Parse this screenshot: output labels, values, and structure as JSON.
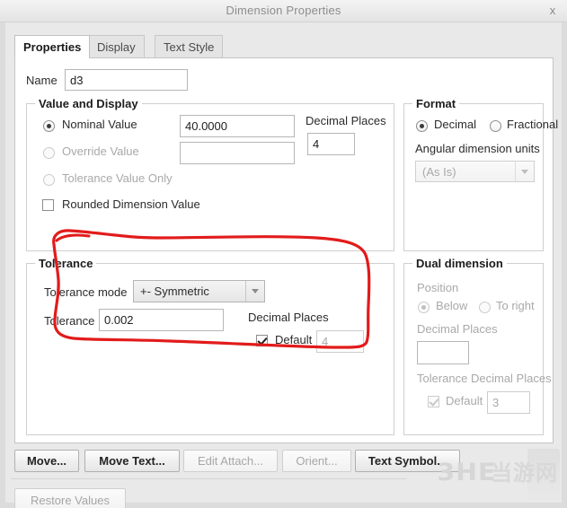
{
  "window": {
    "title": "Dimension Properties",
    "close_label": "x"
  },
  "tabs": [
    {
      "label": "Properties",
      "active": true
    },
    {
      "label": "Display",
      "active": false
    },
    {
      "label": "Text Style",
      "active": false
    }
  ],
  "name_field": {
    "label": "Name",
    "value": "d3"
  },
  "value_and_display": {
    "title": "Value and Display",
    "options": [
      {
        "label": "Nominal Value",
        "selected": true,
        "disabled": false
      },
      {
        "label": "Override Value",
        "selected": false,
        "disabled": true
      },
      {
        "label": "Tolerance Value Only",
        "selected": false,
        "disabled": true
      }
    ],
    "nominal_value": "40.0000",
    "override_value": "",
    "decimal_places_label": "Decimal Places",
    "decimal_places_value": "4",
    "rounded_checkbox": {
      "label": "Rounded Dimension Value",
      "checked": false
    }
  },
  "format": {
    "title": "Format",
    "decimal_label": "Decimal",
    "decimal_selected": true,
    "fractional_label": "Fractional",
    "fractional_selected": false,
    "angular_units_label": "Angular dimension units",
    "angular_units_value": "(As Is)",
    "angular_units_disabled": true
  },
  "tolerance": {
    "title": "Tolerance",
    "mode_label": "Tolerance mode",
    "mode_value": "+- Symmetric",
    "value_label": "Tolerance",
    "value": "0.002",
    "decimal_places_label": "Decimal Places",
    "default_label": "Default",
    "default_checked": true,
    "decimal_places_value": "4"
  },
  "dual_dimension": {
    "title": "Dual dimension",
    "position_label": "Position",
    "below_label": "Below",
    "below_selected": true,
    "to_right_label": "To right",
    "to_right_selected": false,
    "decimal_places_label": "Decimal Places",
    "decimal_places_value": "",
    "tolerance_decimal_places_label": "Tolerance Decimal Places",
    "default_label": "Default",
    "default_checked": true,
    "tolerance_decimal_places_value": "3",
    "disabled": true
  },
  "action_buttons": [
    {
      "label": "Move...",
      "disabled": false
    },
    {
      "label": "Move Text...",
      "disabled": false
    },
    {
      "label": "Edit Attach...",
      "disabled": true
    },
    {
      "label": "Orient...",
      "disabled": true
    },
    {
      "label": "Text Symbol...",
      "disabled": false
    }
  ],
  "footer": {
    "restore_label": "Restore Values",
    "restore_disabled": true
  },
  "annotation": {
    "color": "#e21b1b",
    "shape": "hand-drawn-oval-around-tolerance-group"
  },
  "watermark": {
    "logo_text": "3HE",
    "site_text": "当游网",
    "color": "#d7d7d7"
  }
}
